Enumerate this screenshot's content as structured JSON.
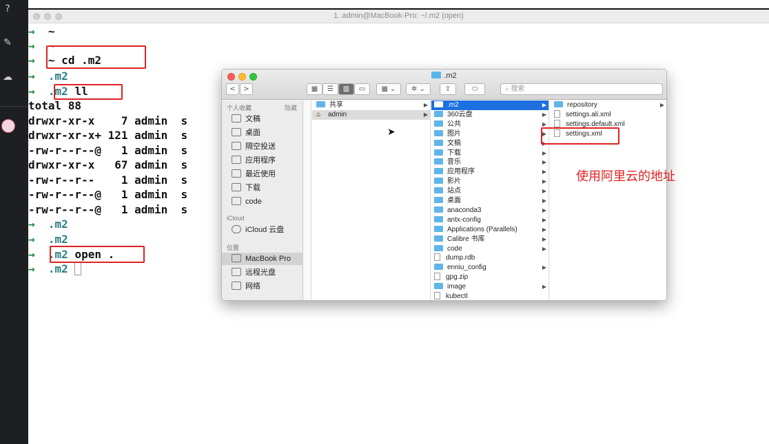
{
  "sidebar": {
    "icons": [
      "question-icon",
      "pencil-icon",
      "cloud-icon",
      "avatar"
    ]
  },
  "terminal": {
    "title": "1. admin@MacBook-Pro: ~/.m2 (open)",
    "lines": [
      {
        "arrow": "→",
        "dir": "~",
        "cmd": ""
      },
      {
        "arrow": "→",
        "dir": "~",
        "cmd": ""
      },
      {
        "arrow": "→",
        "dir": "~",
        "cmd": " cd .m2"
      },
      {
        "arrow": "→",
        "dir": ".m2",
        "cmd": ""
      },
      {
        "arrow": "→",
        "dir": ".m2",
        "cmd": " ll"
      },
      {
        "arrow": "",
        "dir": "",
        "cmd": "total 88"
      },
      {
        "arrow": "",
        "dir": "",
        "cmd": "drwxr-xr-x    7 admin  s"
      },
      {
        "arrow": "",
        "dir": "",
        "cmd": "drwxr-xr-x+ 121 admin  s"
      },
      {
        "arrow": "",
        "dir": "",
        "cmd": "-rw-r--r--@   1 admin  s"
      },
      {
        "arrow": "",
        "dir": "",
        "cmd": "drwxr-xr-x   67 admin  s"
      },
      {
        "arrow": "",
        "dir": "",
        "cmd": "-rw-r--r--    1 admin  s"
      },
      {
        "arrow": "",
        "dir": "",
        "cmd": "-rw-r--r--@   1 admin  s"
      },
      {
        "arrow": "",
        "dir": "",
        "cmd": "-rw-r--r--@   1 admin  s"
      },
      {
        "arrow": "→",
        "dir": ".m2",
        "cmd": ""
      },
      {
        "arrow": "→",
        "dir": ".m2",
        "cmd": ""
      },
      {
        "arrow": "→",
        "dir": ".m2",
        "cmd": " open ."
      },
      {
        "arrow": "→",
        "dir": ".m2",
        "cmd": ""
      }
    ]
  },
  "finder": {
    "title": ".m2",
    "search_placeholder": "搜索",
    "toolbar": {
      "back": "<",
      "forward": ">",
      "view_icon": "▦",
      "view_list": "☰",
      "view_column": "▥",
      "view_cover": "▭",
      "group": "▦ ⌄",
      "action": "✲ ⌄",
      "share": "⇪",
      "tag": "⬭"
    },
    "favorites_header": "个人收藏",
    "hide_label": "隐藏",
    "favorites": [
      "文稿",
      "桌面",
      "隔空投送",
      "应用程序",
      "最近使用",
      "下载",
      "code"
    ],
    "icloud_header": "iCloud",
    "icloud_items": [
      "iCloud 云盘"
    ],
    "locations_header": "位置",
    "locations": [
      "MacBook Pro",
      "远程光盘",
      "网络"
    ],
    "col1": [
      {
        "name": "共享",
        "type": "folder",
        "arrow": true
      },
      {
        "name": "admin",
        "type": "home",
        "arrow": true
      }
    ],
    "col2": [
      {
        "name": ".m2",
        "type": "folder",
        "arrow": true
      },
      {
        "name": "360云盘",
        "type": "folder",
        "arrow": true
      },
      {
        "name": "公共",
        "type": "folder",
        "arrow": true
      },
      {
        "name": "图片",
        "type": "folder",
        "arrow": true
      },
      {
        "name": "文稿",
        "type": "folder",
        "arrow": true
      },
      {
        "name": "下载",
        "type": "folder",
        "arrow": true
      },
      {
        "name": "音乐",
        "type": "folder",
        "arrow": true
      },
      {
        "name": "应用程序",
        "type": "folder",
        "arrow": true
      },
      {
        "name": "影片",
        "type": "folder",
        "arrow": true
      },
      {
        "name": "站点",
        "type": "folder",
        "arrow": true
      },
      {
        "name": "桌面",
        "type": "folder",
        "arrow": true
      },
      {
        "name": "anaconda3",
        "type": "folder",
        "arrow": true
      },
      {
        "name": "antx-config",
        "type": "folder",
        "arrow": true
      },
      {
        "name": "Applications (Parallels)",
        "type": "folder",
        "arrow": true
      },
      {
        "name": "Calibre 书库",
        "type": "folder",
        "arrow": true
      },
      {
        "name": "code",
        "type": "folder",
        "arrow": true
      },
      {
        "name": "dump.rdb",
        "type": "file",
        "arrow": false
      },
      {
        "name": "enniu_config",
        "type": "folder",
        "arrow": true
      },
      {
        "name": "gpg.zip",
        "type": "file",
        "arrow": false
      },
      {
        "name": "image",
        "type": "folder",
        "arrow": true
      },
      {
        "name": "kubectl",
        "type": "file",
        "arrow": false
      }
    ],
    "col3": [
      {
        "name": "repository",
        "type": "folder",
        "arrow": true
      },
      {
        "name": "settings.ali.xml",
        "type": "file",
        "arrow": false
      },
      {
        "name": "settings.default.xml",
        "type": "file",
        "arrow": false
      },
      {
        "name": "settings.xml",
        "type": "file",
        "arrow": false
      }
    ]
  },
  "annotation": "使用阿里云的地址",
  "colors": {
    "red_annotation": "#e02020",
    "prompt_arrow": "#1f8a3b",
    "dir_color": "#2a7e86",
    "selection_blue": "#1e6fe0"
  }
}
